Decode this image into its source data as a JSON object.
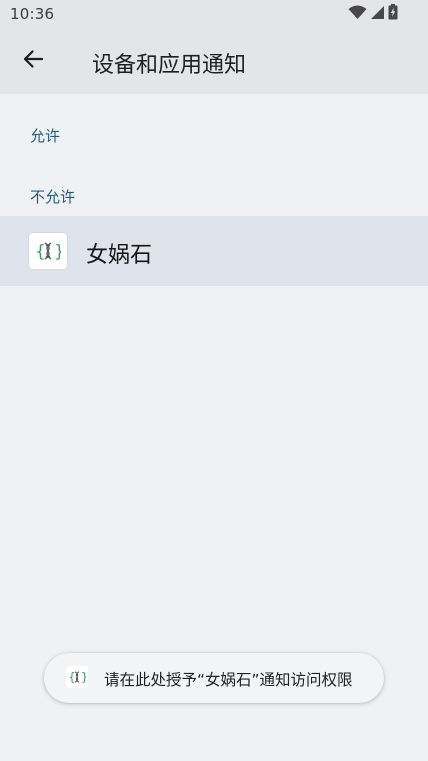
{
  "status_bar": {
    "time": "10:36",
    "icons": [
      "wifi-icon",
      "cellular-signal-icon",
      "battery-charging-icon"
    ]
  },
  "app_bar": {
    "back_icon": "arrow-left-icon",
    "title": "设备和应用通知"
  },
  "sections": {
    "allowed_header": "允许",
    "not_allowed_header": "不允许"
  },
  "apps": [
    {
      "name": "女娲石",
      "icon": "dna-braces-app-icon"
    }
  ],
  "toast": {
    "icon": "dna-braces-app-icon",
    "text": "请在此处授予“女娲石”通知访问权限"
  },
  "colors": {
    "bar_background": "#e4e5e7",
    "page_background": "#eff1f4",
    "section_header": "#1f5e77",
    "selected_row": "#dfe3eb",
    "icon_green": "#3e9a5e"
  }
}
